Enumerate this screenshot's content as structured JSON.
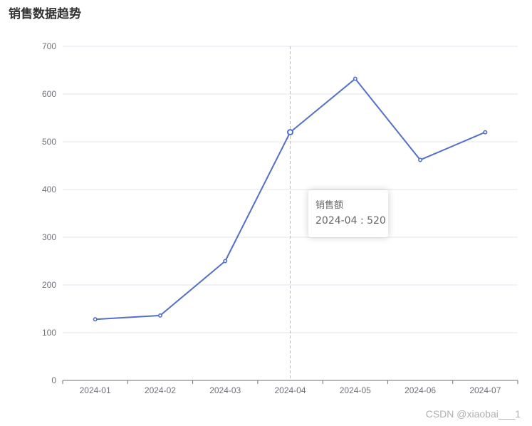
{
  "chart_data": {
    "type": "line",
    "title": "销售数据趋势",
    "categories": [
      "2024-01",
      "2024-02",
      "2024-03",
      "2024-04",
      "2024-05",
      "2024-06",
      "2024-07"
    ],
    "series": [
      {
        "name": "销售额",
        "values": [
          128,
          136,
          250,
          520,
          632,
          462,
          520
        ]
      }
    ],
    "ylim": [
      0,
      700
    ],
    "yticks": [
      0,
      100,
      200,
      300,
      400,
      500,
      600,
      700
    ],
    "grid": true,
    "colors": {
      "line": "#5470c6",
      "grid": "#e0e6f1",
      "axis": "#6e7079",
      "pointer": "#bbbbbb"
    }
  },
  "tooltip": {
    "series_name": "销售额",
    "value_text": "2024-04 : 520",
    "category_index": 3
  },
  "watermark": "CSDN @xiaobai___1"
}
